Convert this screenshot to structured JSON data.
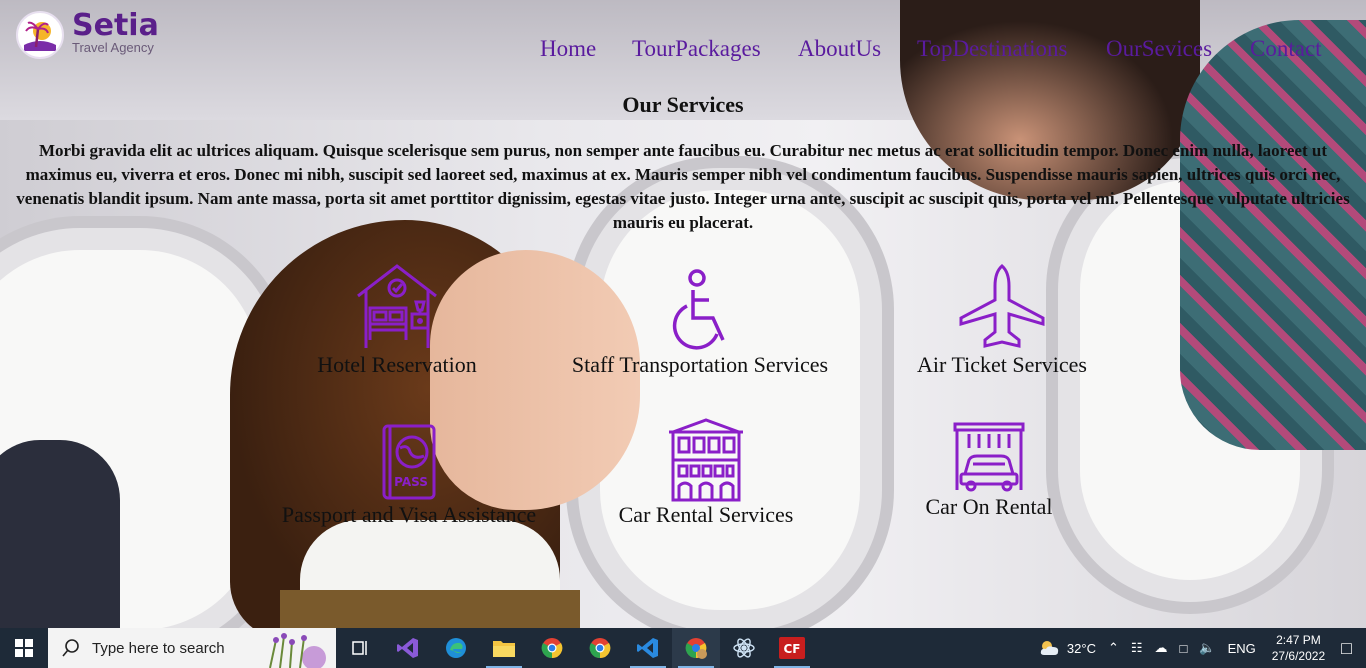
{
  "header": {
    "brand": "Setia",
    "tagline": "Travel Agency",
    "nav": [
      "Home",
      "TourPackages",
      "AboutUs",
      "TopDestinations",
      "OurSevices",
      "Contact"
    ]
  },
  "main": {
    "title": "Our Services",
    "intro": "Morbi gravida elit ac ultrices aliquam. Quisque scelerisque sem purus, non semper ante faucibus eu. Curabitur nec metus ac erat sollicitudin tempor. Donec enim nulla, laoreet ut maximus eu, viverra et eros. Donec mi nibh, suscipit sed laoreet sed, maximus at ex. Mauris semper nibh vel condimentum faucibus. Suspendisse mauris sapien, ultrices quis orci nec, venenatis blandit ipsum. Nam ante massa, porta sit amet porttitor dignissim, egestas vitae justo. Integer urna ante, suscipit ac suscipit quis, porta vel mi. Pellentesque vulputate ultricies mauris eu placerat.",
    "services": [
      {
        "label": "Hotel Reservation",
        "icon": "hotel-bed-icon"
      },
      {
        "label": "Staff Transportation Services",
        "icon": "wheelchair-icon"
      },
      {
        "label": "Air Ticket Services",
        "icon": "airplane-icon"
      },
      {
        "label": "Passport and Visa Assistance",
        "icon": "passport-icon"
      },
      {
        "label": "Car Rental Services",
        "icon": "building-icon"
      },
      {
        "label": "Car On Rental",
        "icon": "car-wash-icon"
      }
    ],
    "icon_color": "#8a1fc8"
  },
  "taskbar": {
    "search_placeholder": "Type here to search",
    "apps": [
      "task-view",
      "visual-studio",
      "edge",
      "file-explorer",
      "chrome",
      "chrome",
      "vscode",
      "chrome-profile",
      "app",
      "app-cf"
    ],
    "weather": "32°C",
    "language": "ENG",
    "time": "2:47 PM",
    "date": "27/6/2022"
  }
}
